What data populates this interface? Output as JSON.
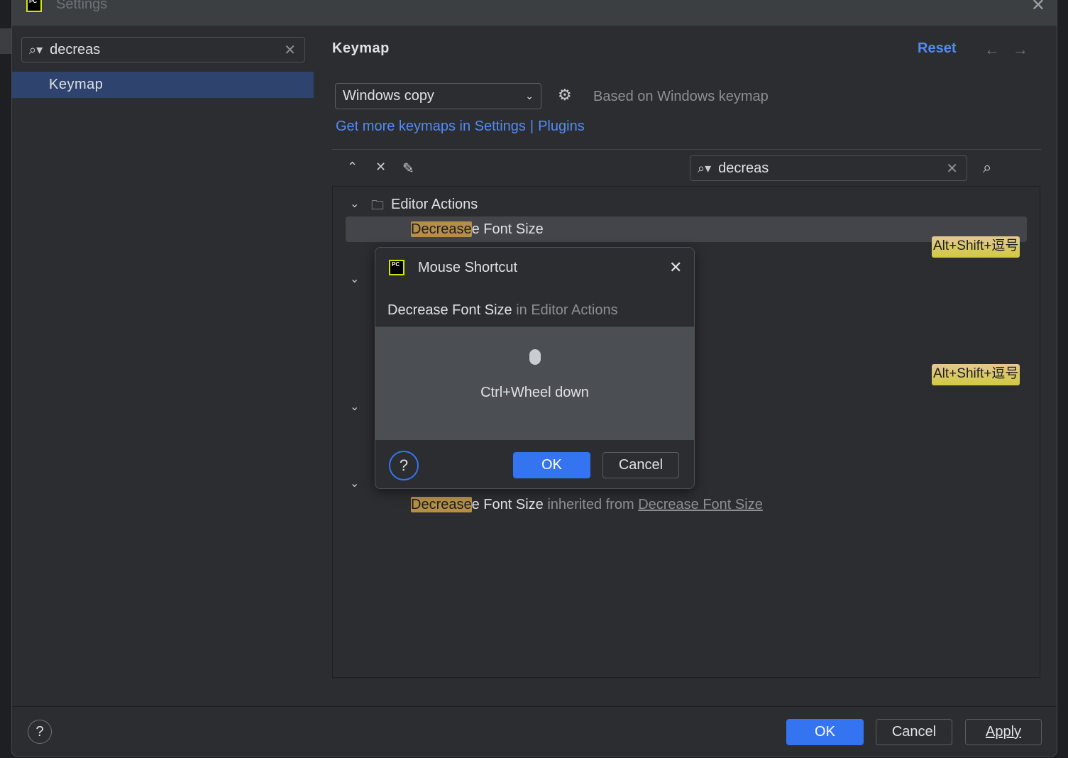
{
  "window": {
    "title": "Settings"
  },
  "sidebar": {
    "search_value": "decreas",
    "items": [
      {
        "label": "Keymap",
        "selected": true
      }
    ]
  },
  "header": {
    "title": "Keymap",
    "reset": "Reset"
  },
  "keymap": {
    "selected": "Windows copy",
    "based_on": "Based on Windows keymap",
    "get_more": "Get more keymaps in Settings",
    "separator": "|",
    "plugins": "Plugins"
  },
  "action_search": {
    "value": "decreas"
  },
  "tree": {
    "group1": "Editor Actions",
    "item1_hl": "Decrease",
    "item1_rest": "e Font Size",
    "shortcut1": "Alt+Shift+逗号",
    "shortcut2": "Alt+Shift+逗号",
    "item_last_hl": "Decrease",
    "item_last_rest": "e Font Size",
    "item_last_inherited": "inherited from",
    "item_last_link": "Decrease Font Size"
  },
  "dialog": {
    "title": "Mouse Shortcut",
    "action": "Decrease Font Size",
    "context": "in Editor Actions",
    "shortcut": "Ctrl+Wheel down",
    "ok": "OK",
    "cancel": "Cancel",
    "help": "?"
  },
  "footer": {
    "ok": "OK",
    "cancel": "Cancel",
    "apply": "Apply",
    "help": "?"
  },
  "colors": {
    "accent": "#3574f0",
    "link": "#548af7",
    "highlight": "#b58f47",
    "shortcut_badge": "#d9c94a"
  }
}
